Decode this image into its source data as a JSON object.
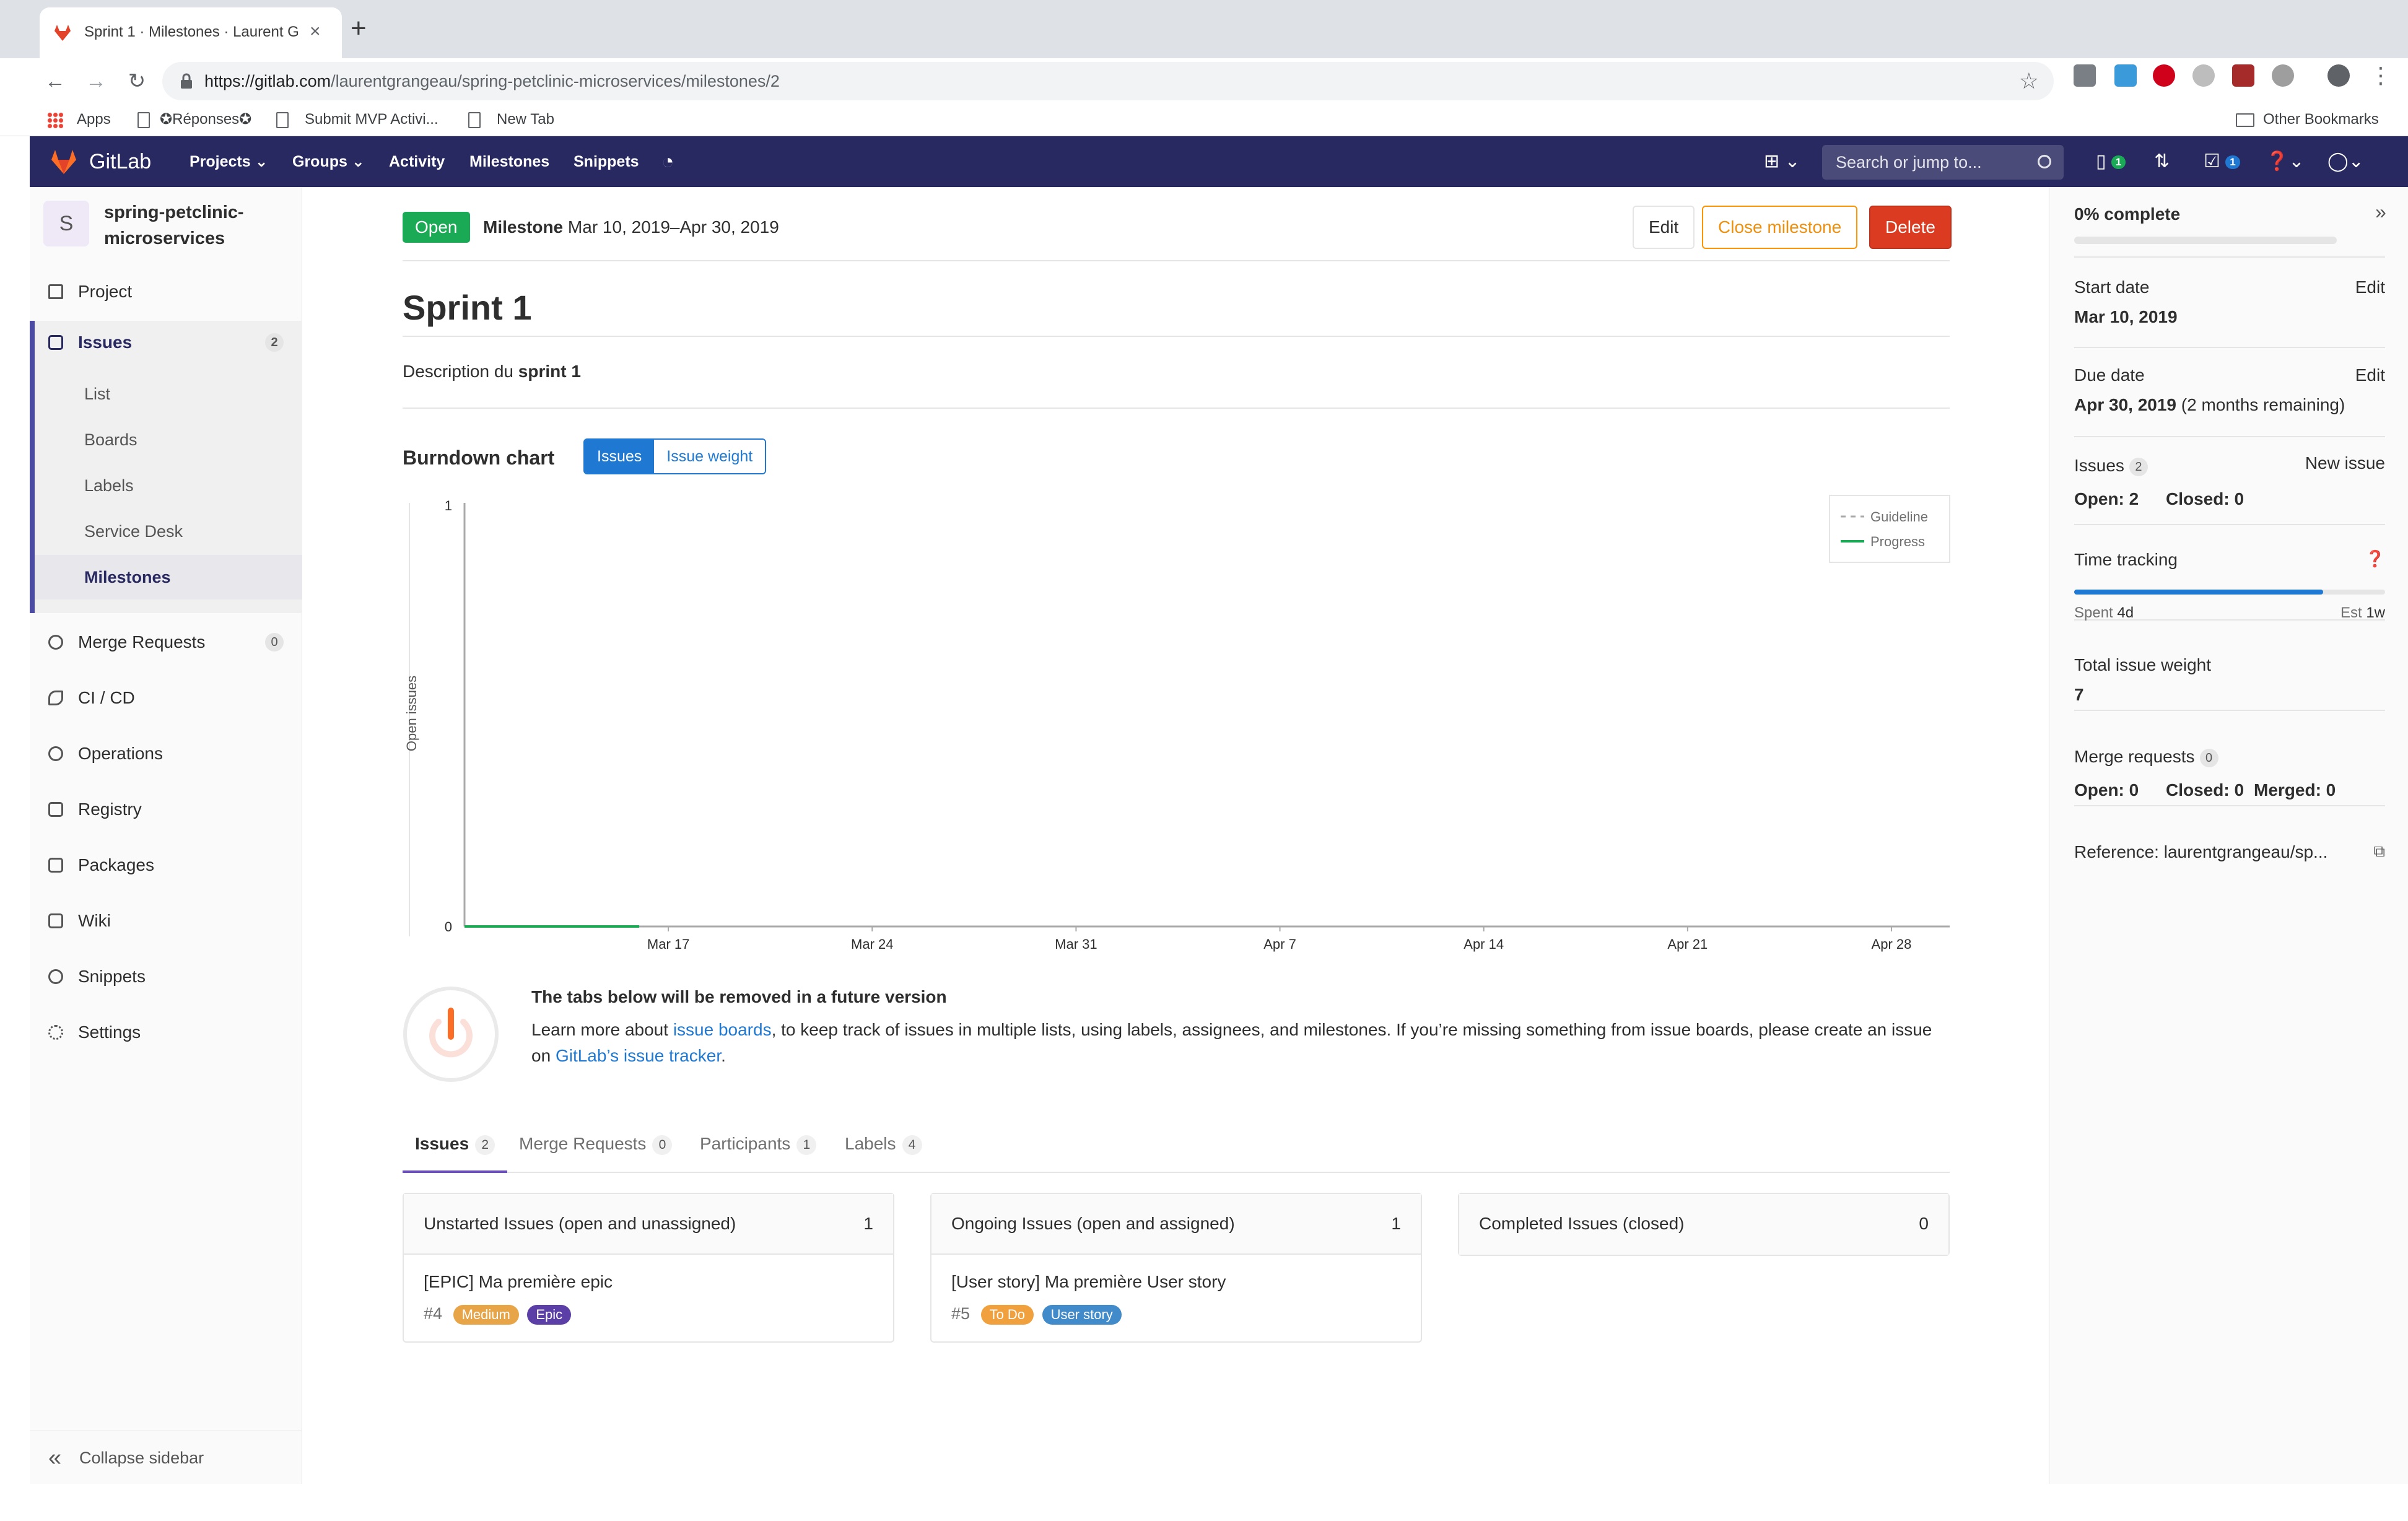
{
  "browser": {
    "tab_title": "Sprint 1 · Milestones · Laurent G",
    "url_host": "https://gitlab.com",
    "url_path": "/laurentgrangeau/spring-petclinic-microservices/milestones/2",
    "bookmarks": [
      "Apps",
      "✪Réponses✪",
      "Submit MVP Activi...",
      "New Tab"
    ],
    "other_bookmarks": "Other Bookmarks"
  },
  "nav": {
    "brand": "GitLab",
    "items": [
      "Projects ⌄",
      "Groups ⌄",
      "Activity",
      "Milestones",
      "Snippets"
    ],
    "search_placeholder": "Search or jump to...",
    "issues_count": "1",
    "todos_count": "1",
    "accent": "#292961"
  },
  "sidebar": {
    "avatar_letter": "S",
    "project_name": "spring-petclinic-microservices",
    "project": "Project",
    "issues": "Issues",
    "issues_count": "2",
    "issue_sub": [
      "List",
      "Boards",
      "Labels",
      "Service Desk",
      "Milestones"
    ],
    "merge_requests": "Merge Requests",
    "mr_count": "0",
    "items": [
      "CI / CD",
      "Operations",
      "Registry",
      "Packages",
      "Wiki",
      "Snippets",
      "Settings"
    ],
    "collapse": "Collapse sidebar"
  },
  "milestone": {
    "status": "Open",
    "label": "Milestone",
    "dates": "Mar 10, 2019–Apr 30, 2019",
    "buttons": {
      "edit": "Edit",
      "close": "Close milestone",
      "delete": "Delete"
    },
    "title": "Sprint 1",
    "description_prefix": "Description du ",
    "description_bold": "sprint 1"
  },
  "burndown": {
    "title": "Burndown chart",
    "toggle": [
      "Issues",
      "Issue weight"
    ],
    "active_toggle": "Issues"
  },
  "chart_data": {
    "type": "line",
    "ylabel": "Open issues",
    "ylim": [
      0,
      1
    ],
    "yticks": [
      "0",
      "1"
    ],
    "xticks": [
      "Mar 17",
      "Mar 24",
      "Mar 31",
      "Apr 7",
      "Apr 14",
      "Apr 21",
      "Apr 28"
    ],
    "xrange": [
      "Mar 10, 2019",
      "Apr 30, 2019"
    ],
    "legend": [
      "Guideline",
      "Progress"
    ],
    "legend_position": "top-right",
    "series": [
      {
        "name": "Guideline",
        "color": "#aaaaaa",
        "style": "dashed",
        "x": [
          "Mar 10, 2019",
          "Apr 30, 2019"
        ],
        "values": [
          0,
          0
        ]
      },
      {
        "name": "Progress",
        "color": "#1aaa55",
        "style": "solid",
        "x": [
          "Mar 10, 2019",
          "Mar 16, 2019"
        ],
        "values": [
          0,
          0
        ]
      }
    ]
  },
  "notice": {
    "title": "The tabs below will be removed in a future version",
    "text_1": "Learn more about ",
    "link_1": "issue boards",
    "text_2": ", to keep track of issues in multiple lists, using labels, assignees, and milestones. If you’re missing something from issue boards, please create an issue on ",
    "link_2": "GitLab’s issue tracker",
    "text_3": "."
  },
  "tabs": [
    {
      "label": "Issues",
      "count": "2"
    },
    {
      "label": "Merge Requests",
      "count": "0"
    },
    {
      "label": "Participants",
      "count": "1"
    },
    {
      "label": "Labels",
      "count": "4"
    }
  ],
  "boards": [
    {
      "title": "Unstarted Issues (open and unassigned)",
      "count": "1",
      "issue": {
        "title": "[EPIC] Ma première epic",
        "ref": "#4",
        "labels": [
          {
            "text": "Medium",
            "color": "#e8a547"
          },
          {
            "text": "Epic",
            "color": "#5b3fa6"
          }
        ]
      }
    },
    {
      "title": "Ongoing Issues (open and assigned)",
      "count": "1",
      "issue": {
        "title": "[User story] Ma première User story",
        "ref": "#5",
        "labels": [
          {
            "text": "To Do",
            "color": "#f0a03c"
          },
          {
            "text": "User story",
            "color": "#428bca"
          }
        ]
      }
    },
    {
      "title": "Completed Issues (closed)",
      "count": "0"
    }
  ],
  "right_sidebar": {
    "complete": "0% complete",
    "complete_fraction": 0,
    "start_date_label": "Start date",
    "start_date": "Mar 10, 2019",
    "due_date_label": "Due date",
    "due_date": "Apr 30, 2019",
    "due_remaining": " (2 months remaining)",
    "edit": "Edit",
    "issues_label": "Issues",
    "issues_count": "2",
    "new_issue": "New issue",
    "issues_open": "Open: 2",
    "issues_closed": "Closed: 0",
    "time_tracking": "Time tracking",
    "spent_label": "Spent ",
    "spent": "4d",
    "est_label": "Est ",
    "est": "1w",
    "time_fraction": 0.8,
    "weight_label": "Total issue weight",
    "weight": "7",
    "mr_label": "Merge requests",
    "mr_count": "0",
    "mr_open": "Open: 0",
    "mr_closed": "Closed: 0",
    "mr_merged": "Merged: 0",
    "reference": "Reference: laurentgrangeau/sp..."
  }
}
